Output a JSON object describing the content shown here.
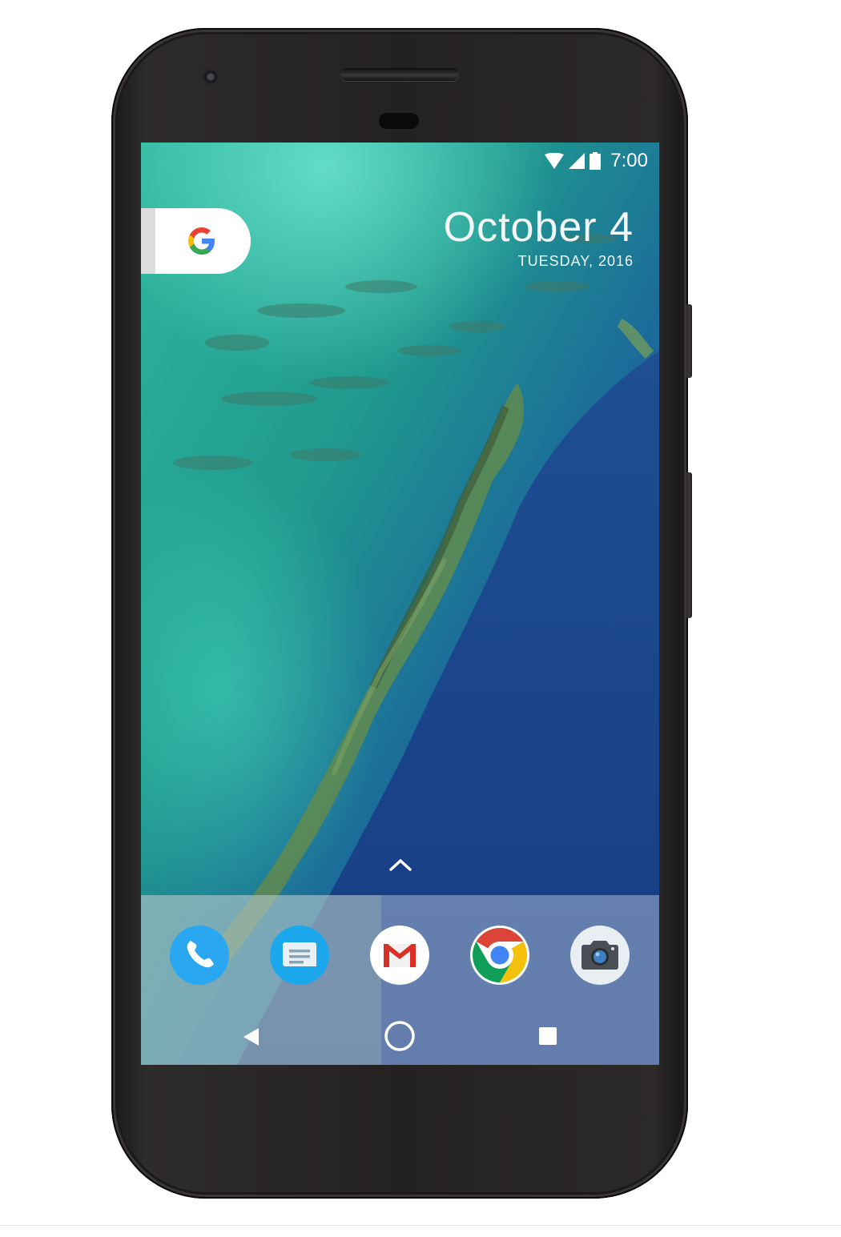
{
  "status_bar": {
    "time": "7:00",
    "icons": [
      "wifi-icon",
      "cellular-signal-icon",
      "battery-icon"
    ]
  },
  "date_widget": {
    "date": "October 4",
    "weekday_year": "TUESDAY, 2016"
  },
  "search_widget": {
    "icon": "google-g-icon"
  },
  "app_drawer_hint": {
    "icon": "chevron-up-icon"
  },
  "dock": {
    "apps": [
      "phone-icon",
      "messages-icon",
      "gmail-icon",
      "chrome-icon",
      "camera-icon"
    ]
  },
  "nav_bar": {
    "buttons": [
      "back-icon",
      "home-icon",
      "recents-icon"
    ]
  },
  "colors": {
    "phone_body": "#242121",
    "dock_overlay": "#cfd8e8",
    "phone_app_blue": "#29a7f0",
    "messages_app_blue": "#1aa7ec",
    "gmail_red": "#d93025",
    "chrome_red": "#db4437",
    "chrome_yellow": "#f4c20d",
    "chrome_green": "#0f9d58",
    "chrome_blue": "#4285f4"
  }
}
